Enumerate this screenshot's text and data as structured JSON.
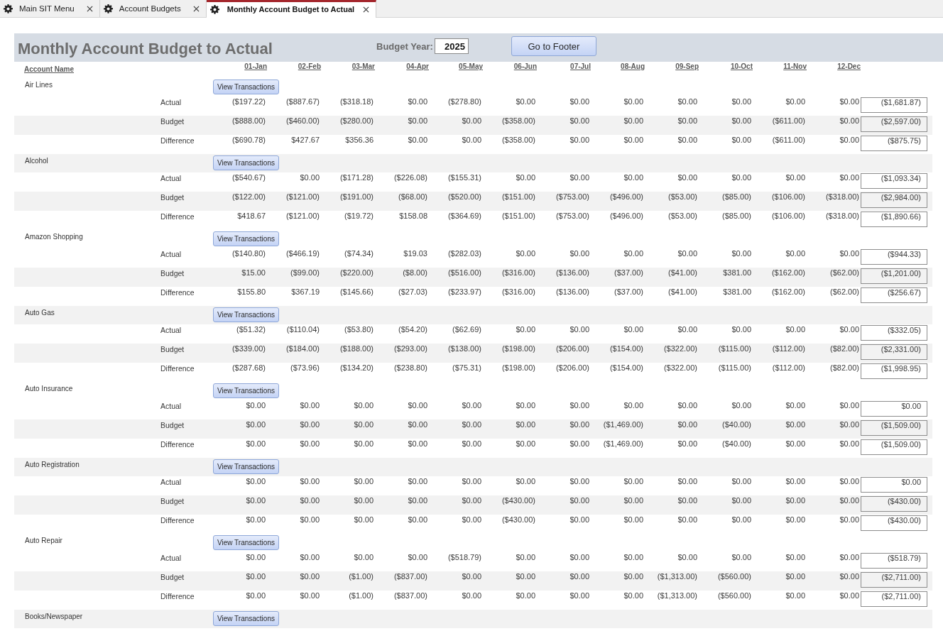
{
  "tabs": [
    {
      "label": "Main SIT Menu",
      "selected": false
    },
    {
      "label": "Account Budgets",
      "selected": false
    },
    {
      "label": "Monthly Account Budget to Actual",
      "selected": true
    }
  ],
  "form": {
    "title": "Monthly Account Budget to Actual",
    "budget_year": {
      "label": "Budget Year:",
      "value": "2025"
    },
    "footer_button": "Go to Footer",
    "columns": {
      "account": "Account Name",
      "months": [
        "01-Jan",
        "02-Feb",
        "03-Mar",
        "04-Apr",
        "05-May",
        "06-Jun",
        "07-Jul",
        "08-Aug",
        "09-Sep",
        "10-Oct",
        "11-Nov",
        "12-Dec"
      ]
    },
    "accounts": [
      {
        "name": "Air Lines",
        "button": "View Transactions",
        "rows": [
          {
            "kind": "actual",
            "label": "Actual",
            "values": [
              "($197.22)",
              "($887.67)",
              "($318.18)",
              "$0.00",
              "($278.80)",
              "$0.00",
              "$0.00",
              "$0.00",
              "$0.00",
              "$0.00",
              "$0.00",
              "$0.00"
            ],
            "total": "($1,681.87)"
          },
          {
            "kind": "budget",
            "label": "Budget",
            "values": [
              "($888.00)",
              "($460.00)",
              "($280.00)",
              "$0.00",
              "$0.00",
              "($358.00)",
              "$0.00",
              "$0.00",
              "$0.00",
              "$0.00",
              "($611.00)",
              "$0.00"
            ],
            "total": "($2,597.00)"
          },
          {
            "kind": "difference",
            "label": "Difference",
            "values": [
              "($690.78)",
              "$427.67",
              "$356.36",
              "$0.00",
              "$0.00",
              "($358.00)",
              "$0.00",
              "$0.00",
              "$0.00",
              "$0.00",
              "($611.00)",
              "$0.00"
            ],
            "total": "($875.75)"
          }
        ]
      },
      {
        "name": "Alcohol",
        "button": "View Transactions",
        "rows": [
          {
            "kind": "actual",
            "label": "Actual",
            "values": [
              "($540.67)",
              "$0.00",
              "($171.28)",
              "($226.08)",
              "($155.31)",
              "$0.00",
              "$0.00",
              "$0.00",
              "$0.00",
              "$0.00",
              "$0.00",
              "$0.00"
            ],
            "total": "($1,093.34)"
          },
          {
            "kind": "budget",
            "label": "Budget",
            "values": [
              "($122.00)",
              "($121.00)",
              "($191.00)",
              "($68.00)",
              "($520.00)",
              "($151.00)",
              "($753.00)",
              "($496.00)",
              "($53.00)",
              "($85.00)",
              "($106.00)",
              "($318.00)"
            ],
            "total": "($2,984.00)"
          },
          {
            "kind": "difference",
            "label": "Difference",
            "values": [
              "$418.67",
              "($121.00)",
              "($19.72)",
              "$158.08",
              "($364.69)",
              "($151.00)",
              "($753.00)",
              "($496.00)",
              "($53.00)",
              "($85.00)",
              "($106.00)",
              "($318.00)"
            ],
            "total": "($1,890.66)"
          }
        ]
      },
      {
        "name": "Amazon Shopping",
        "button": "View Transactions",
        "rows": [
          {
            "kind": "actual",
            "label": "Actual",
            "values": [
              "($140.80)",
              "($466.19)",
              "($74.34)",
              "$19.03",
              "($282.03)",
              "$0.00",
              "$0.00",
              "$0.00",
              "$0.00",
              "$0.00",
              "$0.00",
              "$0.00"
            ],
            "total": "($944.33)"
          },
          {
            "kind": "budget",
            "label": "Budget",
            "values": [
              "$15.00",
              "($99.00)",
              "($220.00)",
              "($8.00)",
              "($516.00)",
              "($316.00)",
              "($136.00)",
              "($37.00)",
              "($41.00)",
              "$381.00",
              "($162.00)",
              "($62.00)"
            ],
            "total": "($1,201.00)"
          },
          {
            "kind": "difference",
            "label": "Difference",
            "values": [
              "$155.80",
              "$367.19",
              "($145.66)",
              "($27.03)",
              "($233.97)",
              "($316.00)",
              "($136.00)",
              "($37.00)",
              "($41.00)",
              "$381.00",
              "($162.00)",
              "($62.00)"
            ],
            "total": "($256.67)"
          }
        ]
      },
      {
        "name": "Auto Gas",
        "button": "View Transactions",
        "rows": [
          {
            "kind": "actual",
            "label": "Actual",
            "values": [
              "($51.32)",
              "($110.04)",
              "($53.80)",
              "($54.20)",
              "($62.69)",
              "$0.00",
              "$0.00",
              "$0.00",
              "$0.00",
              "$0.00",
              "$0.00",
              "$0.00"
            ],
            "total": "($332.05)"
          },
          {
            "kind": "budget",
            "label": "Budget",
            "values": [
              "($339.00)",
              "($184.00)",
              "($188.00)",
              "($293.00)",
              "($138.00)",
              "($198.00)",
              "($206.00)",
              "($154.00)",
              "($322.00)",
              "($115.00)",
              "($112.00)",
              "($82.00)"
            ],
            "total": "($2,331.00)"
          },
          {
            "kind": "difference",
            "label": "Difference",
            "values": [
              "($287.68)",
              "($73.96)",
              "($134.20)",
              "($238.80)",
              "($75.31)",
              "($198.00)",
              "($206.00)",
              "($154.00)",
              "($322.00)",
              "($115.00)",
              "($112.00)",
              "($82.00)"
            ],
            "total": "($1,998.95)"
          }
        ]
      },
      {
        "name": "Auto Insurance",
        "button": "View Transactions",
        "rows": [
          {
            "kind": "actual",
            "label": "Actual",
            "values": [
              "$0.00",
              "$0.00",
              "$0.00",
              "$0.00",
              "$0.00",
              "$0.00",
              "$0.00",
              "$0.00",
              "$0.00",
              "$0.00",
              "$0.00",
              "$0.00"
            ],
            "total": "$0.00"
          },
          {
            "kind": "budget",
            "label": "Budget",
            "values": [
              "$0.00",
              "$0.00",
              "$0.00",
              "$0.00",
              "$0.00",
              "$0.00",
              "$0.00",
              "($1,469.00)",
              "$0.00",
              "($40.00)",
              "$0.00",
              "$0.00"
            ],
            "total": "($1,509.00)"
          },
          {
            "kind": "difference",
            "label": "Difference",
            "values": [
              "$0.00",
              "$0.00",
              "$0.00",
              "$0.00",
              "$0.00",
              "$0.00",
              "$0.00",
              "($1,469.00)",
              "$0.00",
              "($40.00)",
              "$0.00",
              "$0.00"
            ],
            "total": "($1,509.00)"
          }
        ]
      },
      {
        "name": "Auto Registration",
        "button": "View Transactions",
        "rows": [
          {
            "kind": "actual",
            "label": "Actual",
            "values": [
              "$0.00",
              "$0.00",
              "$0.00",
              "$0.00",
              "$0.00",
              "$0.00",
              "$0.00",
              "$0.00",
              "$0.00",
              "$0.00",
              "$0.00",
              "$0.00"
            ],
            "total": "$0.00"
          },
          {
            "kind": "budget",
            "label": "Budget",
            "values": [
              "$0.00",
              "$0.00",
              "$0.00",
              "$0.00",
              "$0.00",
              "($430.00)",
              "$0.00",
              "$0.00",
              "$0.00",
              "$0.00",
              "$0.00",
              "$0.00"
            ],
            "total": "($430.00)"
          },
          {
            "kind": "difference",
            "label": "Difference",
            "values": [
              "$0.00",
              "$0.00",
              "$0.00",
              "$0.00",
              "$0.00",
              "($430.00)",
              "$0.00",
              "$0.00",
              "$0.00",
              "$0.00",
              "$0.00",
              "$0.00"
            ],
            "total": "($430.00)"
          }
        ]
      },
      {
        "name": "Auto Repair",
        "button": "View Transactions",
        "rows": [
          {
            "kind": "actual",
            "label": "Actual",
            "values": [
              "$0.00",
              "$0.00",
              "$0.00",
              "$0.00",
              "($518.79)",
              "$0.00",
              "$0.00",
              "$0.00",
              "$0.00",
              "$0.00",
              "$0.00",
              "$0.00"
            ],
            "total": "($518.79)"
          },
          {
            "kind": "budget",
            "label": "Budget",
            "values": [
              "$0.00",
              "$0.00",
              "($1.00)",
              "($837.00)",
              "$0.00",
              "$0.00",
              "$0.00",
              "$0.00",
              "($1,313.00)",
              "($560.00)",
              "$0.00",
              "$0.00"
            ],
            "total": "($2,711.00)"
          },
          {
            "kind": "difference",
            "label": "Difference",
            "values": [
              "$0.00",
              "$0.00",
              "($1.00)",
              "($837.00)",
              "$0.00",
              "$0.00",
              "$0.00",
              "$0.00",
              "($1,313.00)",
              "($560.00)",
              "$0.00",
              "$0.00"
            ],
            "total": "($2,711.00)"
          }
        ]
      },
      {
        "name": "Books/Newspaper",
        "button": "View Transactions"
      }
    ]
  }
}
